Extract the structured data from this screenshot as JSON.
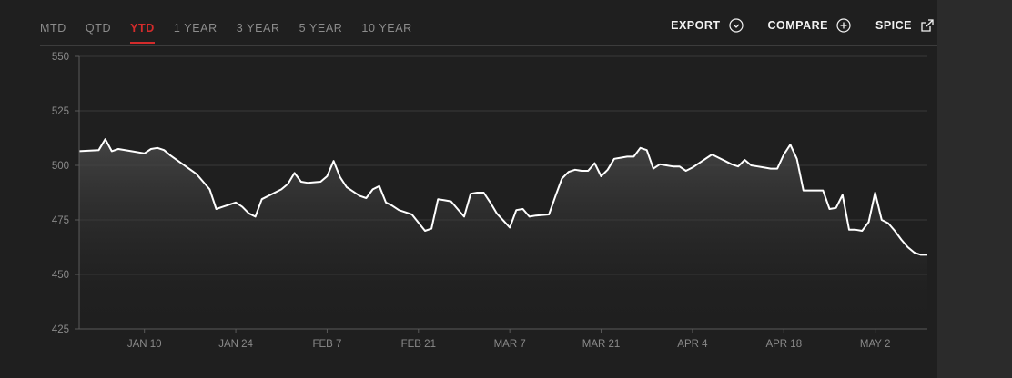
{
  "tabs": [
    {
      "label": "MTD",
      "active": false
    },
    {
      "label": "QTD",
      "active": false
    },
    {
      "label": "YTD",
      "active": true
    },
    {
      "label": "1 YEAR",
      "active": false
    },
    {
      "label": "3 YEAR",
      "active": false
    },
    {
      "label": "5 YEAR",
      "active": false
    },
    {
      "label": "10 YEAR",
      "active": false
    }
  ],
  "actions": {
    "export": {
      "label": "EXPORT",
      "icon": "chevron-circle-down-icon"
    },
    "compare": {
      "label": "COMPARE",
      "icon": "plus-circle-icon"
    },
    "spice": {
      "label": "SPICE",
      "icon": "external-link-icon"
    }
  },
  "colors": {
    "accent": "#d42b2b",
    "line": "#ffffff",
    "grid": "#3a3a3a",
    "panel": "#1f1f1f"
  },
  "chart_data": {
    "type": "area",
    "ylim": [
      425,
      550
    ],
    "yticks": [
      550,
      525,
      500,
      475,
      450,
      425
    ],
    "xticks": [
      {
        "label": "JAN 10",
        "x": 10
      },
      {
        "label": "JAN 24",
        "x": 24
      },
      {
        "label": "FEB 7",
        "x": 38
      },
      {
        "label": "FEB 21",
        "x": 52
      },
      {
        "label": "MAR 7",
        "x": 66
      },
      {
        "label": "MAR 21",
        "x": 80
      },
      {
        "label": "APR 4",
        "x": 94
      },
      {
        "label": "APR 18",
        "x": 108
      },
      {
        "label": "MAY 2",
        "x": 122
      }
    ],
    "xlim": [
      0,
      130
    ],
    "grid": true,
    "x": [
      0,
      3,
      4,
      5,
      6,
      8,
      10,
      11,
      12,
      13,
      14,
      18,
      20,
      21,
      22,
      24,
      25,
      26,
      27,
      28,
      31,
      32,
      33,
      34,
      35,
      37,
      38,
      39,
      40,
      41,
      42,
      43,
      44,
      45,
      46,
      47,
      48,
      49,
      50,
      51,
      53,
      54,
      55,
      56,
      57,
      59,
      60,
      61,
      62,
      63,
      64,
      66,
      67,
      68,
      69,
      70,
      72,
      73,
      74,
      75,
      76,
      77,
      78,
      79,
      80,
      81,
      82,
      83,
      84,
      85,
      86,
      87,
      88,
      89,
      90,
      91,
      92,
      93,
      94,
      95,
      97,
      98,
      99,
      100,
      101,
      102,
      103,
      104,
      105,
      106,
      107,
      108,
      109,
      110,
      111,
      112,
      113,
      114,
      115,
      116,
      117,
      118,
      119,
      120,
      121,
      122,
      123,
      124,
      125,
      126,
      127,
      128,
      129,
      130
    ],
    "y": [
      506.5,
      507,
      512,
      506.5,
      507.5,
      506.5,
      505.5,
      507.5,
      508,
      507,
      504.5,
      496,
      489,
      480,
      481,
      483,
      481,
      478,
      476.5,
      484.5,
      489,
      491.5,
      496.5,
      492.5,
      492,
      492.5,
      495,
      502,
      494.5,
      490,
      488,
      486,
      485,
      489,
      490.5,
      483,
      481.5,
      479.5,
      478.5,
      477.5,
      470,
      471,
      484.5,
      484,
      483.5,
      476.5,
      487,
      487.5,
      487.5,
      483,
      478,
      471.5,
      479.5,
      480,
      476.5,
      477,
      477.5,
      486,
      494,
      497,
      498,
      497.5,
      497.5,
      501,
      495,
      498,
      503,
      503.5,
      504,
      504,
      508,
      507,
      498.5,
      500.5,
      500,
      499.5,
      499.5,
      497.5,
      499,
      501,
      505,
      503.5,
      502,
      500.5,
      499.5,
      502.5,
      500,
      499.5,
      499,
      498.5,
      498.5,
      505,
      509.5,
      503,
      488.5,
      488.5,
      488.5,
      488.5,
      480,
      480.5,
      486.5,
      470.5,
      470.5,
      470,
      474,
      487.5,
      475,
      473.5,
      470,
      466,
      462.5,
      460,
      459,
      459
    ]
  }
}
